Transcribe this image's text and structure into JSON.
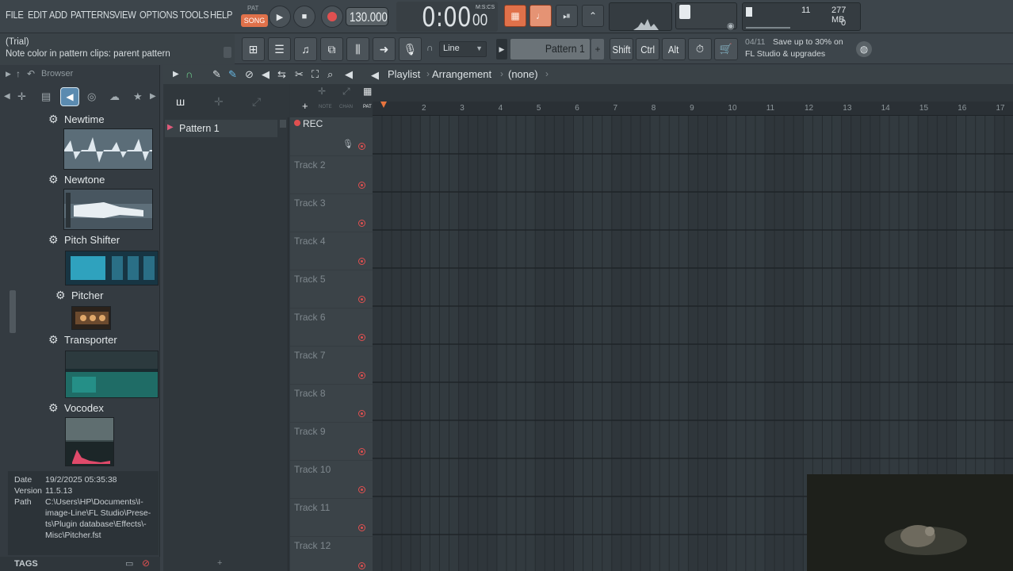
{
  "menu": [
    "FILE",
    "EDIT",
    "ADD",
    "PATTERNS",
    "VIEW",
    "OPTIONS",
    "TOOLS",
    "HELP"
  ],
  "transport": {
    "pat_label": "PAT",
    "song_label": "SONG",
    "tempo": "130.000",
    "time_main": "0:00",
    "time_frac": "00",
    "time_label": "M:S:CS"
  },
  "perf": {
    "cpu_value": "11",
    "memory": "277 MB",
    "polyphony": "0"
  },
  "hint": {
    "title": "(Trial)",
    "text": "Note color in pattern clips: parent pattern"
  },
  "toolbar": {
    "snap_label": "Line",
    "pattern_selector": "Pattern 1",
    "shift_label": "Shift",
    "ctrl_label": "Ctrl",
    "alt_label": "Alt"
  },
  "news": {
    "date": "04/11",
    "line1": "Save up to 30% on",
    "line2": "FL Studio & upgrades"
  },
  "browser": {
    "title": "Browser",
    "plugins": [
      {
        "name": "Newtime"
      },
      {
        "name": "Newtone"
      },
      {
        "name": "Pitch Shifter"
      },
      {
        "name": "Pitcher"
      },
      {
        "name": "Transporter"
      },
      {
        "name": "Vocodex"
      }
    ],
    "info": {
      "date_label": "Date",
      "date_value": "19/2/2025 05:35:38",
      "version_label": "Version",
      "version_value": "11.5.13",
      "path_label": "Path",
      "path_line1": "C:\\Users\\HP\\Documents\\I-",
      "path_line2": "image-Line\\FL Studio\\Prese-",
      "path_line3": "ts\\Plugin database\\Effects\\-",
      "path_line4": "Misc\\Pitcher.fst"
    },
    "tags_label": "TAGS"
  },
  "playlist": {
    "title": "Playlist",
    "section": "Arrangement",
    "selection": "(none)",
    "tabs": [
      "NOTE",
      "CHAN",
      "PAT"
    ],
    "patterns": [
      "Pattern 1"
    ],
    "rec_label": "REC",
    "tracks": [
      "Track 2",
      "Track 3",
      "Track 4",
      "Track 5",
      "Track 6",
      "Track 7",
      "Track 8",
      "Track 9",
      "Track 10",
      "Track 11",
      "Track 12"
    ],
    "bars": [
      "2",
      "3",
      "4",
      "5",
      "6",
      "7",
      "8",
      "9",
      "10",
      "11",
      "12",
      "13",
      "14",
      "15",
      "16",
      "17"
    ]
  },
  "colors": {
    "accent_orange": "#e0714a",
    "record_red": "#e05050",
    "grid_bg": "#2f363b",
    "lcd_text": "#d9dfe2"
  }
}
